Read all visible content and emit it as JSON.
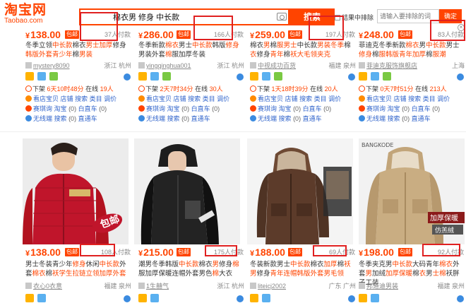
{
  "header": {
    "logo_zh": "淘宝网",
    "logo_en": "Taobao.com",
    "search_query": "棉衣男 修身 中长款",
    "search_button": "搜索",
    "sub_search_label": "结果中排除",
    "sub_search_placeholder": "请输入要排除的词",
    "sub_search_button": "确定"
  },
  "colors": {
    "accent": "#ff4400",
    "annotation": "#e02020",
    "link": "#3366cc"
  },
  "row1": [
    {
      "price": "138.00",
      "baoyou": "包邮",
      "paid": "37人付款",
      "title": [
        "冬季立领",
        "中长款",
        "棉衣",
        "男士加厚",
        "修身",
        "韩版外套青少年",
        "棉",
        "男装"
      ],
      "shop": "mystery8090",
      "location": "浙江 杭州",
      "time_prefix": "下架",
      "time_value": "6天10时48分",
      "online_label": "在线",
      "online_count": "19人",
      "links": [
        [
          "看店宝贝",
          "店铺",
          "搜索",
          "类目",
          "调价"
        ],
        [
          "赛琪询",
          "淘宝",
          "白直车"
        ],
        [
          "无线端",
          "搜索",
          "直通车"
        ]
      ],
      "link_counts": [
        "(0)",
        "(0)",
        "(0)"
      ]
    },
    {
      "price": "286.00",
      "baoyou": "包邮",
      "paid": "166人付款",
      "title": [
        "冬季新款",
        "棉衣",
        "男士",
        "中长款",
        "韩版",
        "修身",
        "男装外套",
        "棉",
        "服加厚冬装"
      ],
      "shop": "yingqinghua001",
      "location": "浙江 杭州",
      "time_prefix": "下架",
      "time_value": "2天7时34分",
      "online_label": "在线",
      "online_count": "30人",
      "links": [
        [
          "看店宝贝",
          "店铺",
          "搜索",
          "类目",
          "调价"
        ],
        [
          "赛琪询",
          "淘宝",
          "白直车"
        ],
        [
          "无线端",
          "搜索",
          "直通车"
        ]
      ],
      "link_counts": [
        "(0)",
        "(0)",
        "(0)"
      ]
    },
    {
      "price": "259.00",
      "baoyou": "包邮",
      "paid": "197人付款",
      "title": [
        "棉衣",
        "男",
        "棉",
        "服男士",
        "中长款",
        "男装冬季",
        "棉",
        "衣",
        "修身",
        "青年",
        "棉",
        "袄大毛领夹克"
      ],
      "shop": "中视成功百货",
      "location": "福建 泉州",
      "time_prefix": "下架",
      "time_value": "1天18时39分",
      "online_label": "在线",
      "online_count": "20人",
      "links": [
        [
          "看店宝贝",
          "店铺",
          "搜索",
          "类目",
          "调价"
        ],
        [
          "赛琪询",
          "淘宝",
          "白直车"
        ],
        [
          "无线端",
          "搜索",
          "直通车"
        ]
      ],
      "link_counts": [
        "(0)",
        "(0)",
        "(0)"
      ]
    },
    {
      "price": "248.00",
      "baoyou": "包邮",
      "paid": "83人付款",
      "title": [
        "菲迪克冬季新款",
        "棉衣",
        "男",
        "中长款",
        "男士",
        "修身",
        "棉",
        "服韩版青年加厚",
        "棉",
        "服潮"
      ],
      "shop": "菲迪克服饰旗舰店",
      "location": "上海",
      "time_prefix": "下架",
      "time_value": "0天7时51分",
      "online_label": "在线",
      "online_count": "213人",
      "links": [
        [
          "看店宝贝",
          "店铺",
          "搜索",
          "类目",
          "调价"
        ],
        [
          "赛琪询",
          "淘宝",
          "白直车"
        ],
        [
          "无线端",
          "搜索",
          "直通车"
        ]
      ],
      "link_counts": [
        "(0)",
        "(0)",
        "(0)"
      ]
    }
  ],
  "row2": [
    {
      "price": "138.00",
      "baoyou": "包邮",
      "paid": "108人付款",
      "title": [
        "男士冬装青少年",
        "修身",
        "休闲",
        "中长款",
        "外套",
        "棉衣",
        "棉",
        "袄学生拉链立领加厚外套"
      ],
      "shop": "衣心0衣意",
      "location": "福建 泉州",
      "photo_caption": "包邮",
      "photo_brand": "MASERATI"
    },
    {
      "price": "215.00",
      "baoyou": "包邮",
      "paid": "175人付款",
      "title": [
        "潮男冬季韩版",
        "中长款",
        "棉衣",
        "男",
        "修身",
        "棉",
        "服加厚保暖连帽外套男色",
        "棉",
        "大衣"
      ],
      "shop": "1生囍气",
      "location": "浙江 杭州",
      "photo_caption": "",
      "photo_brand": ""
    },
    {
      "price": "188.00",
      "baoyou": "包邮",
      "paid": "69人付款",
      "title": [
        "冬装新款男士",
        "中长款",
        "棉衣",
        "加厚",
        "棉",
        "袄男",
        "修身",
        "青年连帽韩版外套男毛领"
      ],
      "shop": "liteicj2002",
      "location": "广东 广州",
      "photo_caption": "",
      "photo_brand": ""
    },
    {
      "price": "198.00",
      "baoyou": "包邮",
      "paid": "92人付款",
      "title": [
        "冬季夹克男",
        "中长款",
        "大码青年",
        "棉衣",
        "外套",
        "男",
        "加绒",
        "加厚保暖",
        "棉",
        "衣",
        "男",
        "士棉",
        "袄胖子工装"
      ],
      "shop": "邦道迪男装",
      "location": "福建 泉州",
      "photo_caption": "加厚保暖",
      "photo_brand": "BANGKODE",
      "photo_caption2": "仿羔绒"
    }
  ]
}
